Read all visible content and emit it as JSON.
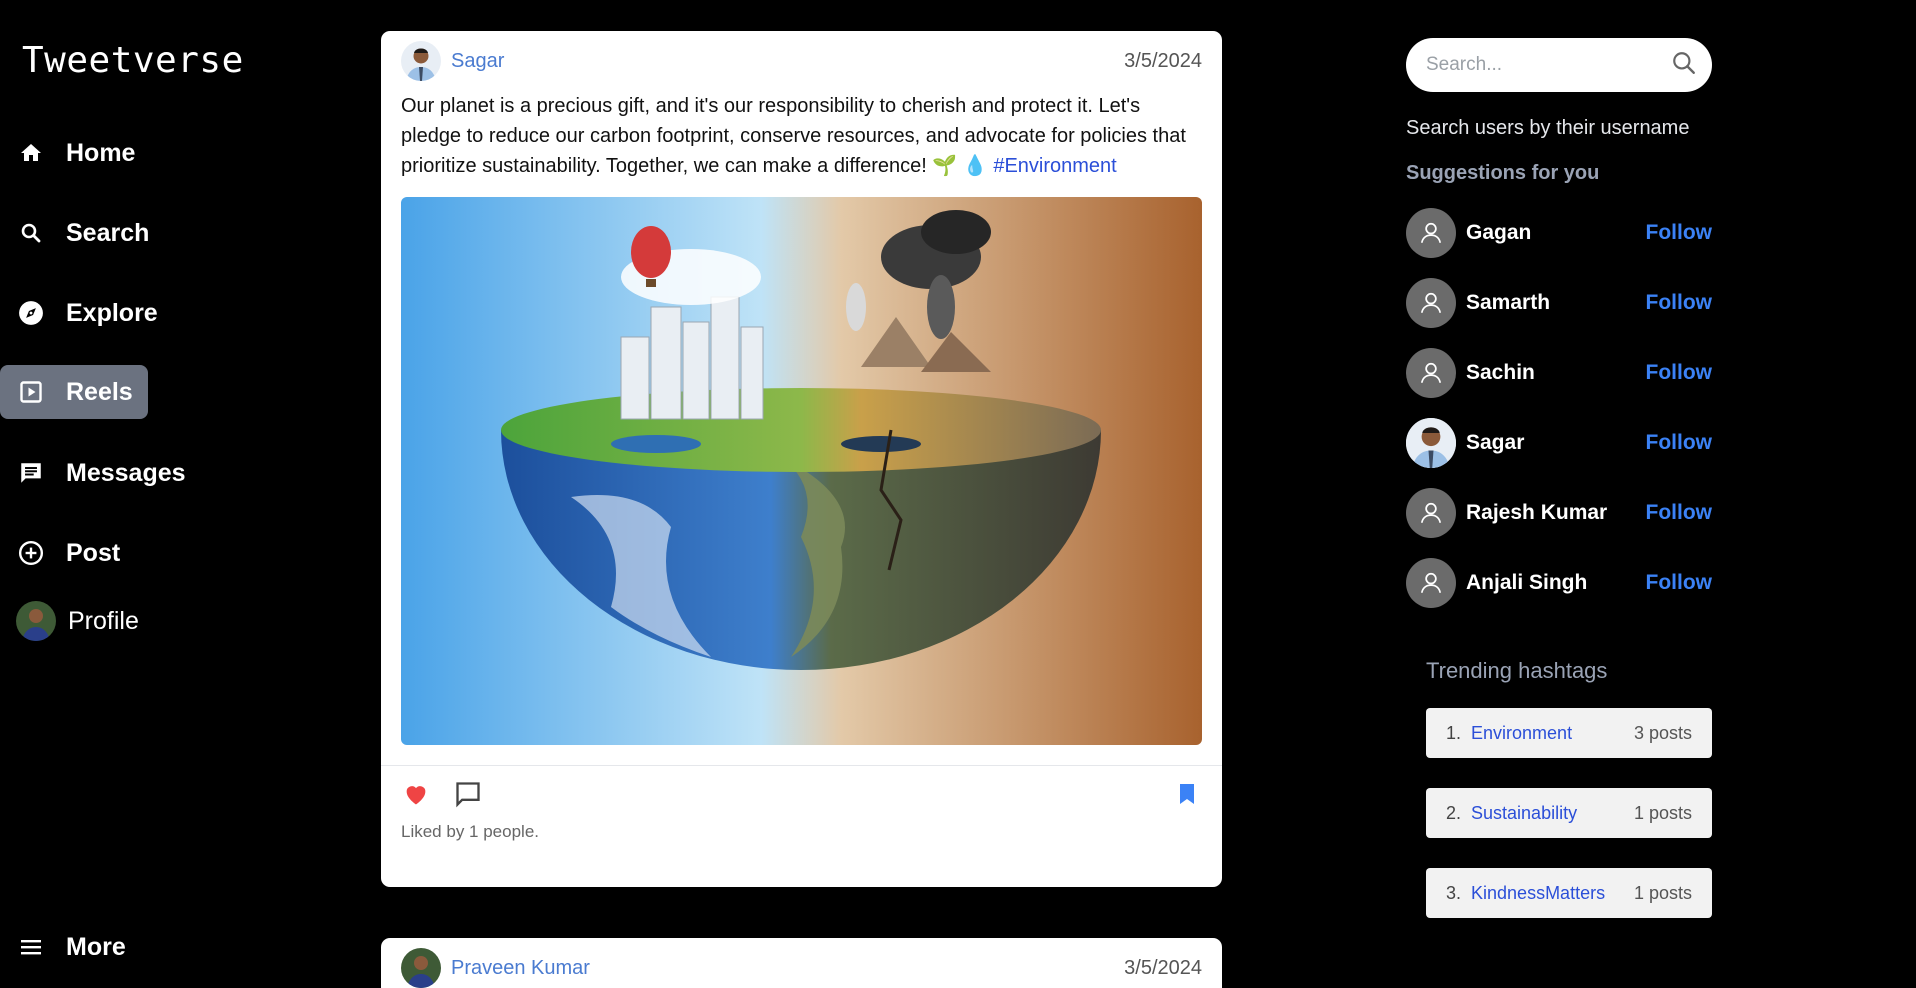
{
  "app": {
    "title": "Tweetverse"
  },
  "nav": {
    "items": [
      {
        "label": "Home",
        "icon": "home-icon"
      },
      {
        "label": "Search",
        "icon": "search-icon"
      },
      {
        "label": "Explore",
        "icon": "compass-icon"
      },
      {
        "label": "Reels",
        "icon": "reels-icon",
        "active": true
      },
      {
        "label": "Messages",
        "icon": "message-icon"
      },
      {
        "label": "Post",
        "icon": "plus-circle-icon"
      },
      {
        "label": "Profile",
        "icon": "avatar"
      }
    ],
    "more_label": "More"
  },
  "feed": {
    "posts": [
      {
        "author": "Sagar",
        "date": "3/5/2024",
        "text": "Our planet is a precious gift, and it's our responsibility to cherish and protect it. Let's pledge to reduce our carbon footprint, conserve resources, and advocate for policies that prioritize sustainability. Together, we can make a difference! 🌱 💧",
        "hashtag": "#Environment",
        "liked": true,
        "bookmarked": true,
        "likes_text": "Liked by 1 people."
      },
      {
        "author": "Praveen Kumar",
        "date": "3/5/2024"
      }
    ]
  },
  "right": {
    "search": {
      "placeholder": "Search..."
    },
    "search_hint": "Search users by their username",
    "suggestions_title": "Suggestions for you",
    "follow_label": "Follow",
    "suggestions": [
      {
        "name": "Gagan"
      },
      {
        "name": "Samarth"
      },
      {
        "name": "Sachin"
      },
      {
        "name": "Sagar"
      },
      {
        "name": "Rajesh Kumar"
      },
      {
        "name": "Anjali Singh"
      }
    ],
    "trending_title": "Trending hashtags",
    "trending": [
      {
        "num": "1.",
        "tag": "Environment",
        "count": "3 posts"
      },
      {
        "num": "2.",
        "tag": "Sustainability",
        "count": "1 posts"
      },
      {
        "num": "3.",
        "tag": "KindnessMatters",
        "count": "1 posts"
      }
    ]
  },
  "colors": {
    "accent": "#3b82f6",
    "like": "#ef4444",
    "link": "#4a7bd0",
    "active_nav": "#6b7280"
  }
}
